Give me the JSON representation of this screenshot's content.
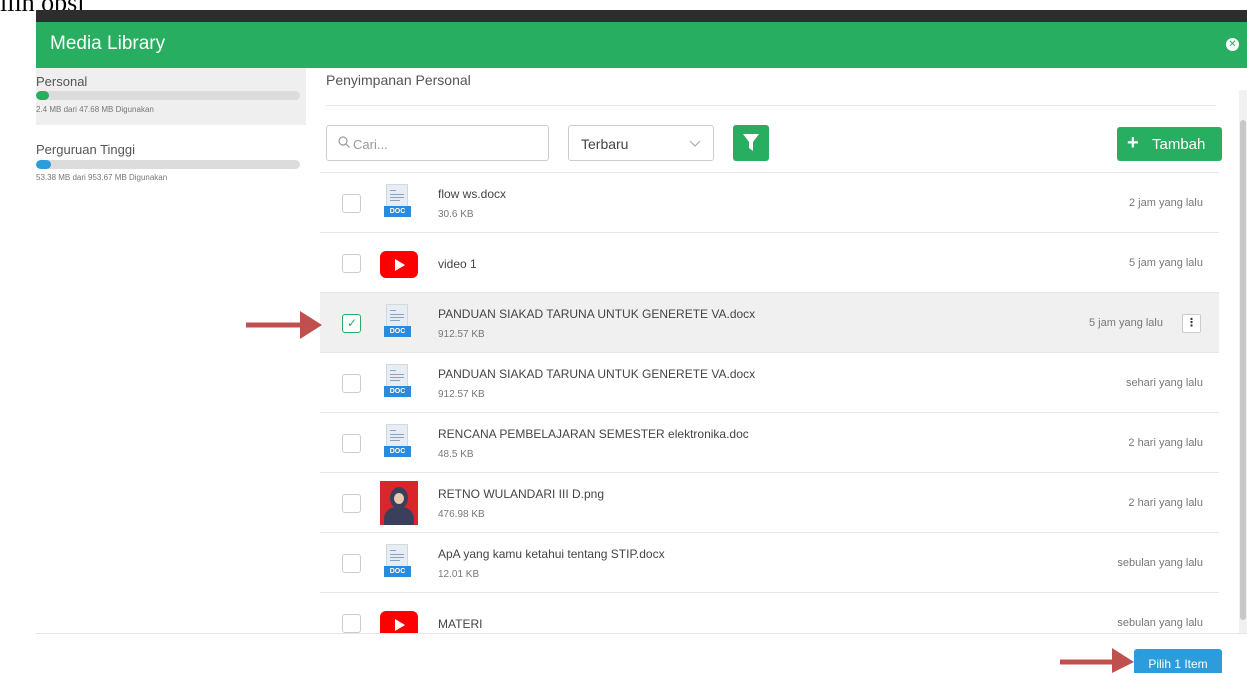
{
  "page": {
    "top_text": "ilih opsi"
  },
  "modal": {
    "title": "Media Library",
    "close_icon": "close-icon"
  },
  "sidebar": {
    "storages": [
      {
        "name": "Personal",
        "usage": "2.4 MB dari 47.68 MB Digunakan",
        "used_fraction": 0.05,
        "color": "#27ae60",
        "active": true
      },
      {
        "name": "Perguruan Tinggi",
        "usage": "53.38 MB dari 953.67 MB Digunakan",
        "used_fraction": 0.056,
        "color": "#2d9cdb",
        "active": false
      }
    ]
  },
  "main": {
    "section_title": "Penyimpanan Personal",
    "search": {
      "placeholder": "Cari...",
      "icon": "search-icon"
    },
    "sort": {
      "value": "Terbaru",
      "icon": "chevron-down-icon"
    },
    "filter": {
      "icon": "filter-icon"
    },
    "add": {
      "label": "Tambah",
      "icon": "plus-icon"
    }
  },
  "files": [
    {
      "name": "flow ws.docx",
      "size": "30.6 KB",
      "time": "2 jam yang lalu",
      "type": "doc",
      "checked": false
    },
    {
      "name": "video 1",
      "size": "",
      "time": "5 jam yang lalu",
      "type": "youtube",
      "checked": false
    },
    {
      "name": "PANDUAN SIAKAD TARUNA UNTUK GENERETE VA.docx",
      "size": "912.57 KB",
      "time": "5 jam yang lalu",
      "type": "doc",
      "checked": true
    },
    {
      "name": "PANDUAN SIAKAD TARUNA UNTUK GENERETE VA.docx",
      "size": "912.57 KB",
      "time": "sehari yang lalu",
      "type": "doc",
      "checked": false
    },
    {
      "name": "RENCANA PEMBELAJARAN SEMESTER elektronika.doc",
      "size": "48.5 KB",
      "time": "2 hari yang lalu",
      "type": "doc",
      "checked": false
    },
    {
      "name": "RETNO WULANDARI III D.png",
      "size": "476.98 KB",
      "time": "2 hari yang lalu",
      "type": "image",
      "checked": false
    },
    {
      "name": "ApA yang kamu ketahui tentang STIP.docx",
      "size": "12.01 KB",
      "time": "sebulan yang lalu",
      "type": "doc",
      "checked": false
    },
    {
      "name": "MATERI",
      "size": "",
      "time": "sebulan yang lalu",
      "type": "youtube",
      "checked": false
    }
  ],
  "doc_badge": "DOC",
  "more_icon": "more-vertical-icon",
  "footer": {
    "pick_label": "Pilih 1 Item"
  },
  "annotations": {
    "arrow_color": "#c0504d"
  }
}
